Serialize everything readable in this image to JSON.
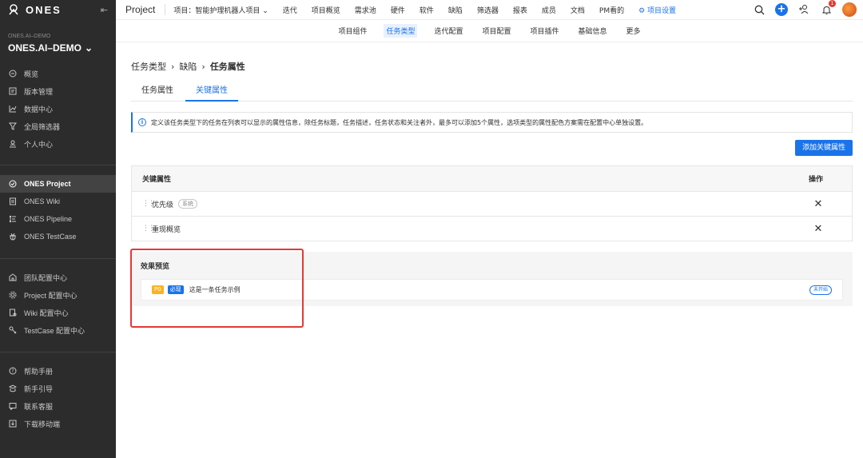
{
  "sidebar": {
    "logo_text": "ONES",
    "org_label": "ONES.AI–DEMO",
    "org_name": "ONES.AI–DEMO",
    "main_nav": [
      {
        "label": "概览",
        "icon": "compass-icon"
      },
      {
        "label": "版本管理",
        "icon": "version-icon"
      },
      {
        "label": "数据中心",
        "icon": "chart-icon"
      },
      {
        "label": "全局筛选器",
        "icon": "filter-icon"
      },
      {
        "label": "个人中心",
        "icon": "user-icon"
      }
    ],
    "products": [
      {
        "label": "ONES Project",
        "icon": "check-circle-icon",
        "active": true
      },
      {
        "label": "ONES Wiki",
        "icon": "wiki-icon"
      },
      {
        "label": "ONES Pipeline",
        "icon": "pipeline-icon"
      },
      {
        "label": "ONES TestCase",
        "icon": "bug-icon"
      }
    ],
    "config": [
      {
        "label": "团队配置中心",
        "icon": "team-icon"
      },
      {
        "label": "Project 配置中心",
        "icon": "gear-icon"
      },
      {
        "label": "Wiki 配置中心",
        "icon": "wiki-config-icon"
      },
      {
        "label": "TestCase 配置中心",
        "icon": "testcase-config-icon"
      }
    ],
    "help": [
      {
        "label": "帮助手册",
        "icon": "help-icon"
      },
      {
        "label": "新手引导",
        "icon": "guide-icon"
      },
      {
        "label": "联系客服",
        "icon": "chat-icon"
      },
      {
        "label": "下载移动端",
        "icon": "download-icon"
      }
    ]
  },
  "topbar": {
    "title": "Project",
    "items": [
      {
        "label": "项目：智能护理机器人项目 ⌄"
      },
      {
        "label": "迭代"
      },
      {
        "label": "项目概览"
      },
      {
        "label": "需求池"
      },
      {
        "label": "硬件"
      },
      {
        "label": "软件"
      },
      {
        "label": "缺陷"
      },
      {
        "label": "筛选器"
      },
      {
        "label": "报表"
      },
      {
        "label": "成员"
      },
      {
        "label": "文档"
      },
      {
        "label": "PM看的"
      },
      {
        "label": "⚙ 项目设置",
        "active": true
      }
    ],
    "notification_count": "1"
  },
  "subnav": {
    "items": [
      {
        "label": "项目组件"
      },
      {
        "label": "任务类型",
        "active": true
      },
      {
        "label": "迭代配置"
      },
      {
        "label": "项目配置"
      },
      {
        "label": "项目插件"
      },
      {
        "label": "基础信息"
      },
      {
        "label": "更多"
      }
    ]
  },
  "breadcrumb": {
    "items": [
      "任务类型",
      "缺陷",
      "任务属性"
    ],
    "separator": "›"
  },
  "tabs": {
    "items": [
      {
        "label": "任务属性"
      },
      {
        "label": "关键属性",
        "active": true
      }
    ]
  },
  "info_bar": {
    "text": "定义该任务类型下的任务在列表可以显示的属性信息，除任务标题，任务描述，任务状态和关注者外，最多可以添加5个属性，选项类型的属性配色方案需在配置中心单独设置。"
  },
  "add_button": {
    "label": "添加关键属性"
  },
  "attr_table": {
    "header_name": "关键属性",
    "header_op": "操作",
    "rows": [
      {
        "name": "优先级",
        "tag": "系统"
      },
      {
        "name": "重现概览",
        "tag": ""
      }
    ]
  },
  "preview": {
    "title": "效果预览",
    "priority_tag": "P0",
    "required_tag": "必现",
    "example_text": "这是一条任务示例",
    "status_tag": "未开始"
  },
  "colors": {
    "accent": "#1a73e8",
    "sidebar_bg": "#2c2c2c",
    "highlight_box": "#e53935",
    "priority_tag": "#fbb320"
  }
}
